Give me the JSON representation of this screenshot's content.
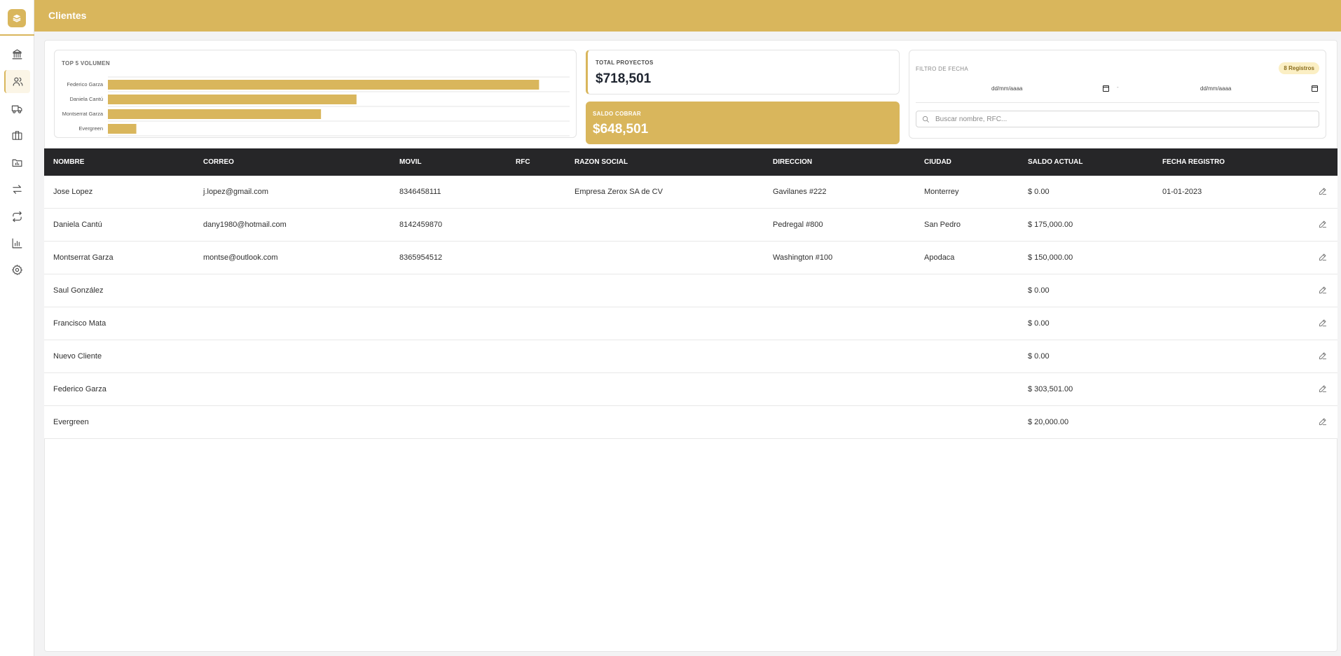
{
  "header": {
    "title": "Clientes"
  },
  "sidebar": {
    "items": [
      {
        "icon": "bank-icon",
        "active": false
      },
      {
        "icon": "users-icon",
        "active": true
      },
      {
        "icon": "truck-icon",
        "active": false
      },
      {
        "icon": "briefcase-icon",
        "active": false
      },
      {
        "icon": "folder-chart-icon",
        "active": false
      },
      {
        "icon": "transfer-icon",
        "active": false
      },
      {
        "icon": "repeat-icon",
        "active": false
      },
      {
        "icon": "bar-chart-icon",
        "active": false
      },
      {
        "icon": "settings-icon",
        "active": false
      }
    ]
  },
  "stats": {
    "chart_title": "TOP 5 VOLUMEN",
    "total_label": "TOTAL PROYECTOS",
    "total_value": "$718,501",
    "saldo_label": "SALDO COBRAR",
    "saldo_value": "$648,501"
  },
  "chart_data": {
    "type": "bar",
    "orientation": "horizontal",
    "title": "TOP 5 VOLUMEN",
    "categories": [
      "Federico Garza",
      "Daniela Cantú",
      "Montserrat Garza",
      "Evergreen"
    ],
    "values": [
      303501,
      175000,
      150000,
      20000
    ],
    "xlim": [
      0,
      325000
    ],
    "color": "#d9b65c",
    "grid": true
  },
  "filter": {
    "label": "FILTRO DE FECHA",
    "badge": "8 Registros",
    "date_from_placeholder": "dd/mm/aaaa",
    "date_to_placeholder": "dd/mm/aaaa",
    "separator": "-",
    "search_placeholder": "Buscar nombre, RFC..."
  },
  "table": {
    "columns": [
      "NOMBRE",
      "CORREO",
      "MOVIL",
      "RFC",
      "RAZON SOCIAL",
      "DIRECCION",
      "CIUDAD",
      "SALDO ACTUAL",
      "FECHA REGISTRO"
    ],
    "rows": [
      [
        "Jose Lopez",
        "j.lopez@gmail.com",
        "8346458111",
        "",
        "Empresa Zerox SA de CV",
        "Gavilanes #222",
        "Monterrey",
        "$ 0.00",
        "01-01-2023"
      ],
      [
        "Daniela Cantú",
        "dany1980@hotmail.com",
        "8142459870",
        "",
        "",
        "Pedregal #800",
        "San Pedro",
        "$ 175,000.00",
        ""
      ],
      [
        "Montserrat Garza",
        "montse@outlook.com",
        "8365954512",
        "",
        "",
        "Washington #100",
        "Apodaca",
        "$ 150,000.00",
        ""
      ],
      [
        "Saul González",
        "",
        "",
        "",
        "",
        "",
        "",
        "$ 0.00",
        ""
      ],
      [
        "Francisco Mata",
        "",
        "",
        "",
        "",
        "",
        "",
        "$ 0.00",
        ""
      ],
      [
        "Nuevo Cliente",
        "",
        "",
        "",
        "",
        "",
        "",
        "$ 0.00",
        ""
      ],
      [
        "Federico Garza",
        "",
        "",
        "",
        "",
        "",
        "",
        "$ 303,501.00",
        ""
      ],
      [
        "Evergreen",
        "",
        "",
        "",
        "",
        "",
        "",
        "$ 20,000.00",
        ""
      ]
    ]
  }
}
